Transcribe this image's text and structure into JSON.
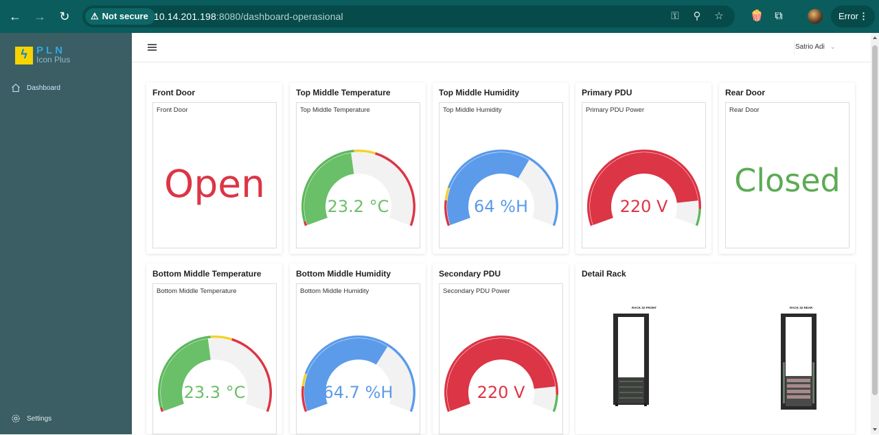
{
  "browser": {
    "security_label": "Not secure",
    "url_host": "10.14.201.198",
    "url_rest": ":8080/dashboard-operasional",
    "profile_status": "Error"
  },
  "sidebar": {
    "logo_title": "PLN",
    "logo_subtitle": "Icon Plus",
    "items": [
      {
        "label": "Dashboard",
        "icon": "home-icon"
      },
      {
        "label": "Settings",
        "icon": "gear-icon"
      }
    ]
  },
  "topbar": {
    "user_name": "Satrio Adi"
  },
  "colors": {
    "red": "#dc3545",
    "green": "#5cb85c",
    "blue": "#5b9bea",
    "yellow": "#f5d131",
    "track": "#f2f2f2"
  },
  "cards": [
    {
      "title": "Front Door",
      "panel_title": "Front Door",
      "type": "status",
      "value": "Open",
      "color": "#dc3545"
    },
    {
      "title": "Top Middle Temperature",
      "panel_title": "Top Middle Temperature",
      "type": "gauge",
      "value": 23.2,
      "display": "23.2 °C",
      "color": "#6abf69",
      "min": 0,
      "max": 50,
      "bands": [
        "red",
        "green",
        "yellow",
        "red"
      ]
    },
    {
      "title": "Top Middle Humidity",
      "panel_title": "Top Middle Humidity",
      "type": "gauge",
      "value": 64,
      "display": "64 %H",
      "color": "#5b9bea",
      "min": 0,
      "max": 100,
      "bands": [
        "red",
        "yellow",
        "blue",
        "blue"
      ]
    },
    {
      "title": "Primary PDU",
      "panel_title": "Primary PDU Power",
      "type": "gauge",
      "value": 220,
      "display": "220 V",
      "color": "#dc3545",
      "min": 0,
      "max": 250,
      "bands": [
        "red",
        "red",
        "red",
        "green"
      ]
    },
    {
      "title": "Rear Door",
      "panel_title": "Rear Door",
      "type": "status",
      "value": "Closed",
      "color": "#5cab55"
    },
    {
      "title": "Bottom Middle Temperature",
      "panel_title": "Bottom Middle Temperature",
      "type": "gauge",
      "value": 23.3,
      "display": "23.3 °C",
      "color": "#6abf69",
      "min": 0,
      "max": 50,
      "bands": [
        "red",
        "green",
        "yellow",
        "red"
      ]
    },
    {
      "title": "Bottom Middle Humidity",
      "panel_title": "Bottom Middle Humidity",
      "type": "gauge",
      "value": 64.7,
      "display": "64.7 %H",
      "color": "#5b9bea",
      "min": 0,
      "max": 100,
      "bands": [
        "red",
        "yellow",
        "blue",
        "blue"
      ]
    },
    {
      "title": "Secondary PDU",
      "panel_title": "Secondary PDU Power",
      "type": "gauge",
      "value": 220,
      "display": "220 V",
      "color": "#dc3545",
      "min": 0,
      "max": 250,
      "bands": [
        "red",
        "red",
        "red",
        "green"
      ]
    }
  ],
  "detail_rack": {
    "title": "Detail Rack",
    "front_label": "RACK 32 FRONT",
    "rear_label": "RACK 32 REAR"
  }
}
